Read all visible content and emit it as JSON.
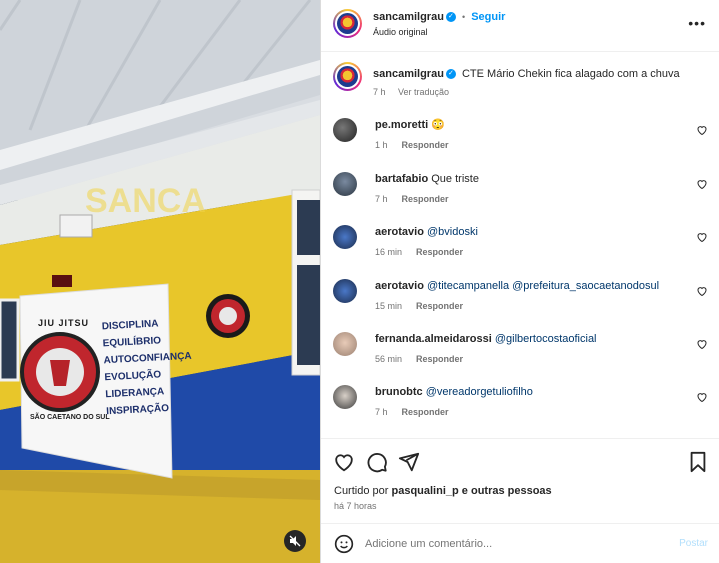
{
  "header": {
    "username": "sancamilgrau",
    "dot": "•",
    "follow_label": "Seguir",
    "audio_label": "Áudio original",
    "more_icon": "more-horizontal-icon"
  },
  "caption": {
    "username": "sancamilgrau",
    "text": "CTE Mário Chekin fica alagado com a chuva",
    "time": "7 h",
    "translate_label": "Ver tradução"
  },
  "comments": [
    {
      "username": "pe.moretti",
      "text": "😳",
      "mention": "",
      "time": "1 h",
      "reply": "Responder"
    },
    {
      "username": "bartafabio",
      "text": "Que triste",
      "mention": "",
      "time": "7 h",
      "reply": "Responder"
    },
    {
      "username": "aerotavio",
      "text": "",
      "mention": "@bvidoski",
      "time": "16 min",
      "reply": "Responder"
    },
    {
      "username": "aerotavio",
      "text": "",
      "mention": "@titecampanella @prefeitura_saocaetanodosul",
      "time": "15 min",
      "reply": "Responder"
    },
    {
      "username": "fernanda.almeidarossi",
      "text": "",
      "mention": "@gilbertocostaoficial",
      "time": "56 min",
      "reply": "Responder"
    },
    {
      "username": "brunobtc",
      "text": "",
      "mention": "@vereadorgetuliofilho",
      "time": "7 h",
      "reply": "Responder"
    }
  ],
  "likes": {
    "prefix": "Curtido por",
    "user": "pasqualini_p",
    "suffix": "e outras pessoas",
    "time": "há 7 horas"
  },
  "add_comment": {
    "placeholder": "Adicione um comentário...",
    "post_label": "Postar"
  },
  "media": {
    "banner_title": "JIU JITSU",
    "banner_subtitle": "SÃO CAETANO DO SUL",
    "banner_words": [
      "DISCIPLINA",
      "EQUILÍBRIO",
      "AUTOCONFIANÇA",
      "EVOLUÇÃO",
      "LIDERANÇA",
      "INSPIRAÇÃO"
    ],
    "watermark": "SANCA",
    "mute_icon": "speaker-muted-icon"
  },
  "colors": {
    "accent": "#0095f6",
    "wall_yellow": "#e8c62a",
    "wall_blue": "#1f4aa8",
    "floor": "#d9b62b"
  }
}
